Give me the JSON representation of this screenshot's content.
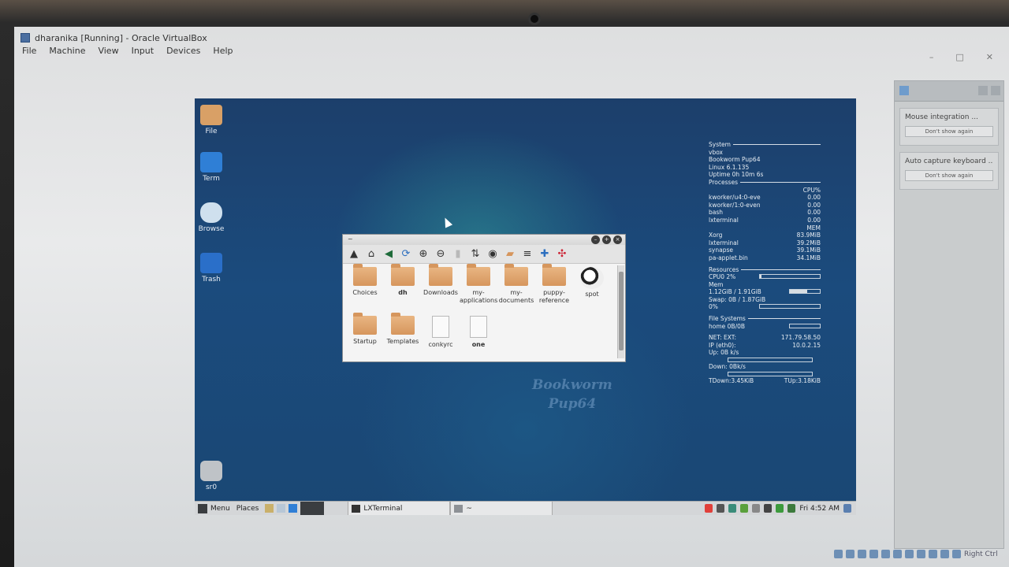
{
  "window": {
    "title": "dharanika [Running] - Oracle VirtualBox",
    "controls": [
      "–",
      "□",
      "✕"
    ]
  },
  "menubar": [
    "File",
    "Machine",
    "View",
    "Input",
    "Devices",
    "Help"
  ],
  "notifications": {
    "items": [
      {
        "title": "Mouse integration ...",
        "button": "Don't show again"
      },
      {
        "title": "Auto capture keyboard ...",
        "button": "Don't show again"
      }
    ],
    "status_right": "Right Ctrl"
  },
  "desktop": {
    "icons": [
      {
        "label": "File",
        "icon": "folder-home-icon",
        "color": "#d9a066"
      },
      {
        "label": "Term",
        "icon": "terminal-icon",
        "color": "#2f7fd6"
      },
      {
        "label": "Browse",
        "icon": "cloud-icon",
        "color": "#cfe0ee"
      },
      {
        "label": "Trash",
        "icon": "recycle-icon",
        "color": "#2a6fc9"
      },
      {
        "label": "sr0",
        "icon": "disc-drive-icon",
        "color": "#bfc3c7"
      }
    ],
    "wallpaper_text": [
      "Bookworm",
      "Pup64"
    ]
  },
  "conky": {
    "system_header": "System",
    "system_lines": [
      "vbox",
      "Bookworm Pup64",
      "Linux 6.1.135",
      "Uptime 0h 10m 6s"
    ],
    "processes_header": "Processes",
    "cpu_col": "CPU%",
    "cpu_procs": [
      {
        "name": "kworker/u4:0-eve",
        "val": "0.00"
      },
      {
        "name": "kworker/1:0-even",
        "val": "0.00"
      },
      {
        "name": "bash",
        "val": "0.00"
      },
      {
        "name": "lxterminal",
        "val": "0.00"
      }
    ],
    "mem_col": "MEM",
    "mem_procs": [
      {
        "name": "Xorg",
        "val": "83.9MiB"
      },
      {
        "name": "lxterminal",
        "val": "39.2MiB"
      },
      {
        "name": "synapse",
        "val": "39.1MiB"
      },
      {
        "name": "pa-applet.bin",
        "val": "34.1MiB"
      }
    ],
    "resources_header": "Resources",
    "cpu0": "CPU0 2%",
    "cpu0_fraction": 0.02,
    "mem_label": "Mem",
    "mem_value": "1.12GiB / 1.91GiB",
    "mem_fraction": 0.59,
    "swap_value": "Swap: 0B / 1.87GiB",
    "swap_pct": "0%",
    "swap_fraction": 0.0,
    "fs_header": "File Systems",
    "fs_home": "home 0B/0B",
    "net_ext_label": "NET: EXT:",
    "net_ext_value": "171.79.58.50",
    "ip_label": "IP (eth0):",
    "ip_value": "10.0.2.15",
    "up": "Up: 0B k/s",
    "down": "Down: 0Bk/s",
    "tdown": "TDown:3.45KiB",
    "tup": "TUp:3.18KiB"
  },
  "file_manager": {
    "title": "~",
    "toolbar_icons": [
      "up-arrow-icon",
      "home-icon",
      "back-icon",
      "refresh-icon",
      "zoom-in-icon",
      "zoom-out-icon",
      "delete-icon",
      "sort-icon",
      "eye-icon",
      "folder-icon",
      "list-icon",
      "plus-icon",
      "fullscreen-icon"
    ],
    "items": [
      {
        "label": "Choices",
        "type": "folder",
        "bold": false
      },
      {
        "label": "dh",
        "type": "folder",
        "bold": true
      },
      {
        "label": "Downloads",
        "type": "folder",
        "bold": false
      },
      {
        "label": "my-applications",
        "type": "folder",
        "bold": false
      },
      {
        "label": "my-documents",
        "type": "folder",
        "bold": false
      },
      {
        "label": "puppy-reference",
        "type": "folder",
        "bold": false
      },
      {
        "label": "spot",
        "type": "spot",
        "bold": false
      },
      {
        "label": "Startup",
        "type": "folder",
        "bold": false
      },
      {
        "label": "Templates",
        "type": "folder",
        "bold": false
      },
      {
        "label": "conkyrc",
        "type": "file",
        "bold": false
      },
      {
        "label": "one",
        "type": "file",
        "bold": true
      }
    ]
  },
  "taskbar": {
    "menu": "Menu",
    "places": "Places",
    "task": "LXTerminal",
    "task2": "~",
    "clock": "Fri 4:52 AM"
  }
}
